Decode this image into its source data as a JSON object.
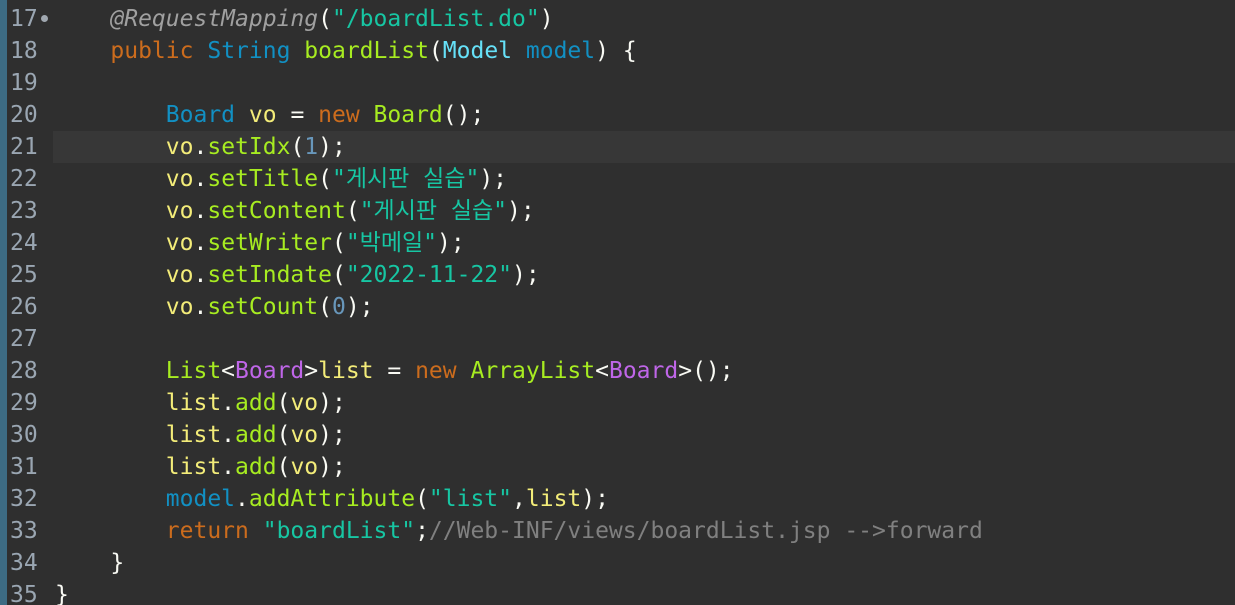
{
  "editor": {
    "lines": [
      {
        "num": "17",
        "fold": true,
        "tokens": [
          {
            "t": "    "
          },
          {
            "t": "@RequestMapping",
            "c": "ann"
          },
          {
            "t": "(",
            "c": "pun"
          },
          {
            "t": "\"/boardList.do\"",
            "c": "str"
          },
          {
            "t": ")",
            "c": "pun"
          }
        ]
      },
      {
        "num": "18",
        "tokens": [
          {
            "t": "    "
          },
          {
            "t": "public",
            "c": "kw"
          },
          {
            "t": " "
          },
          {
            "t": "String",
            "c": "typ"
          },
          {
            "t": " "
          },
          {
            "t": "boardList",
            "c": "mth"
          },
          {
            "t": "(",
            "c": "pun"
          },
          {
            "t": "Model",
            "c": "fld"
          },
          {
            "t": " "
          },
          {
            "t": "model",
            "c": "typ"
          },
          {
            "t": ") {",
            "c": "pun"
          }
        ]
      },
      {
        "num": "19",
        "tokens": []
      },
      {
        "num": "20",
        "tokens": [
          {
            "t": "        "
          },
          {
            "t": "Board",
            "c": "typ"
          },
          {
            "t": " "
          },
          {
            "t": "vo",
            "c": "var"
          },
          {
            "t": " = ",
            "c": "pun"
          },
          {
            "t": "new",
            "c": "kw"
          },
          {
            "t": " "
          },
          {
            "t": "Board",
            "c": "mth"
          },
          {
            "t": "();",
            "c": "pun"
          }
        ]
      },
      {
        "num": "21",
        "current": true,
        "tokens": [
          {
            "t": "        "
          },
          {
            "t": "vo",
            "c": "var"
          },
          {
            "t": ".",
            "c": "pun"
          },
          {
            "t": "setIdx",
            "c": "call"
          },
          {
            "t": "(",
            "c": "pun"
          },
          {
            "t": "1",
            "c": "num"
          },
          {
            "t": ");",
            "c": "pun"
          }
        ]
      },
      {
        "num": "22",
        "tokens": [
          {
            "t": "        "
          },
          {
            "t": "vo",
            "c": "var"
          },
          {
            "t": ".",
            "c": "pun"
          },
          {
            "t": "setTitle",
            "c": "call"
          },
          {
            "t": "(",
            "c": "pun"
          },
          {
            "t": "\"게시판 실습\"",
            "c": "str"
          },
          {
            "t": ");",
            "c": "pun"
          }
        ]
      },
      {
        "num": "23",
        "tokens": [
          {
            "t": "        "
          },
          {
            "t": "vo",
            "c": "var"
          },
          {
            "t": ".",
            "c": "pun"
          },
          {
            "t": "setContent",
            "c": "call"
          },
          {
            "t": "(",
            "c": "pun"
          },
          {
            "t": "\"게시판 실습\"",
            "c": "str"
          },
          {
            "t": ");",
            "c": "pun"
          }
        ]
      },
      {
        "num": "24",
        "tokens": [
          {
            "t": "        "
          },
          {
            "t": "vo",
            "c": "var"
          },
          {
            "t": ".",
            "c": "pun"
          },
          {
            "t": "setWriter",
            "c": "call"
          },
          {
            "t": "(",
            "c": "pun"
          },
          {
            "t": "\"박메일\"",
            "c": "str"
          },
          {
            "t": ");",
            "c": "pun"
          }
        ]
      },
      {
        "num": "25",
        "tokens": [
          {
            "t": "        "
          },
          {
            "t": "vo",
            "c": "var"
          },
          {
            "t": ".",
            "c": "pun"
          },
          {
            "t": "setIndate",
            "c": "call"
          },
          {
            "t": "(",
            "c": "pun"
          },
          {
            "t": "\"2022-11-22\"",
            "c": "str"
          },
          {
            "t": ");",
            "c": "pun"
          }
        ]
      },
      {
        "num": "26",
        "tokens": [
          {
            "t": "        "
          },
          {
            "t": "vo",
            "c": "var"
          },
          {
            "t": ".",
            "c": "pun"
          },
          {
            "t": "setCount",
            "c": "call"
          },
          {
            "t": "(",
            "c": "pun"
          },
          {
            "t": "0",
            "c": "num"
          },
          {
            "t": ");",
            "c": "pun"
          }
        ]
      },
      {
        "num": "27",
        "tokens": []
      },
      {
        "num": "28",
        "tokens": [
          {
            "t": "        "
          },
          {
            "t": "List",
            "c": "mth"
          },
          {
            "t": "<",
            "c": "pun"
          },
          {
            "t": "Board",
            "c": "gen"
          },
          {
            "t": ">",
            "c": "pun"
          },
          {
            "t": "list",
            "c": "var"
          },
          {
            "t": " = ",
            "c": "pun"
          },
          {
            "t": "new",
            "c": "kw"
          },
          {
            "t": " "
          },
          {
            "t": "ArrayList",
            "c": "mth"
          },
          {
            "t": "<",
            "c": "pun"
          },
          {
            "t": "Board",
            "c": "gen"
          },
          {
            "t": ">();",
            "c": "pun"
          }
        ]
      },
      {
        "num": "29",
        "tokens": [
          {
            "t": "        "
          },
          {
            "t": "list",
            "c": "var"
          },
          {
            "t": ".",
            "c": "pun"
          },
          {
            "t": "add",
            "c": "call"
          },
          {
            "t": "(",
            "c": "pun"
          },
          {
            "t": "vo",
            "c": "var"
          },
          {
            "t": ");",
            "c": "pun"
          }
        ]
      },
      {
        "num": "30",
        "tokens": [
          {
            "t": "        "
          },
          {
            "t": "list",
            "c": "var"
          },
          {
            "t": ".",
            "c": "pun"
          },
          {
            "t": "add",
            "c": "call"
          },
          {
            "t": "(",
            "c": "pun"
          },
          {
            "t": "vo",
            "c": "var"
          },
          {
            "t": ");",
            "c": "pun"
          }
        ]
      },
      {
        "num": "31",
        "tokens": [
          {
            "t": "        "
          },
          {
            "t": "list",
            "c": "var"
          },
          {
            "t": ".",
            "c": "pun"
          },
          {
            "t": "add",
            "c": "call"
          },
          {
            "t": "(",
            "c": "pun"
          },
          {
            "t": "vo",
            "c": "var"
          },
          {
            "t": ");",
            "c": "pun"
          }
        ]
      },
      {
        "num": "32",
        "tokens": [
          {
            "t": "        "
          },
          {
            "t": "model",
            "c": "typ"
          },
          {
            "t": ".",
            "c": "pun"
          },
          {
            "t": "addAttribute",
            "c": "call"
          },
          {
            "t": "(",
            "c": "pun"
          },
          {
            "t": "\"list\"",
            "c": "str"
          },
          {
            "t": ",",
            "c": "pun"
          },
          {
            "t": "list",
            "c": "var"
          },
          {
            "t": ");",
            "c": "pun"
          }
        ]
      },
      {
        "num": "33",
        "tokens": [
          {
            "t": "        "
          },
          {
            "t": "return",
            "c": "kw"
          },
          {
            "t": " "
          },
          {
            "t": "\"boardList\"",
            "c": "str"
          },
          {
            "t": ";",
            "c": "pun"
          },
          {
            "t": "//Web-INF/views/boardList.jsp -->forward",
            "c": "cmt"
          }
        ]
      },
      {
        "num": "34",
        "tokens": [
          {
            "t": "    "
          },
          {
            "t": "}",
            "c": "pun"
          }
        ]
      },
      {
        "num": "35",
        "tokens": [
          {
            "t": "}",
            "c": "pun"
          }
        ]
      }
    ]
  }
}
